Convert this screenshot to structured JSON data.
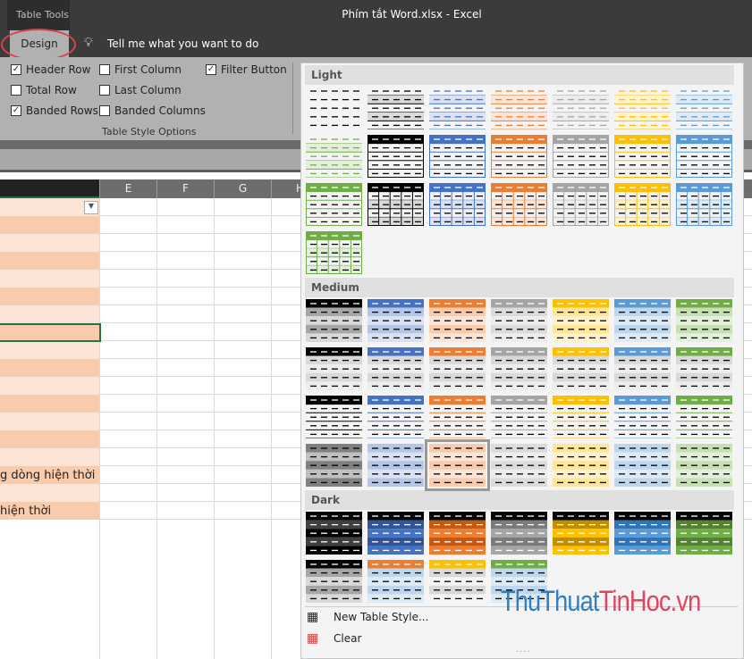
{
  "titlebar": {
    "context_tab": "Table Tools",
    "title": "Phím tắt Word.xlsx  -  Excel"
  },
  "tabs": {
    "design": "Design",
    "tell_me": "Tell me what you want to do"
  },
  "options": {
    "header_row": {
      "label": "Header Row",
      "checked": true
    },
    "total_row": {
      "label": "Total Row",
      "checked": false
    },
    "banded_rows": {
      "label": "Banded Rows",
      "checked": true
    },
    "first_column": {
      "label": "First Column",
      "checked": false
    },
    "last_column": {
      "label": "Last Column",
      "checked": false
    },
    "banded_columns": {
      "label": "Banded Columns",
      "checked": false
    },
    "filter_button": {
      "label": "Filter Button",
      "checked": true
    },
    "group_label": "Table Style Options"
  },
  "columns": [
    "E",
    "F",
    "G",
    "H"
  ],
  "rows": [
    "",
    "",
    "",
    "",
    "",
    "",
    "",
    "",
    "",
    "",
    "",
    "",
    "",
    "",
    "",
    "g dòng hiện thời",
    "",
    "hiện thời"
  ],
  "gallery": {
    "light_label": "Light",
    "medium_label": "Medium",
    "dark_label": "Dark",
    "colors": {
      "none": "#000000",
      "black": "#000000",
      "blue": "#4472c4",
      "orange": "#ed7d31",
      "gray": "#a5a5a5",
      "gold": "#ffc000",
      "lightblue": "#5b9bd5",
      "green": "#70ad47"
    },
    "selected": "Medium 10",
    "new_style": "New Table Style...",
    "clear": "Clear"
  },
  "watermark": {
    "part1": "ThuThuat",
    "part2": "TinHoc",
    "part3": ".vn",
    "color1": "#2f7fc1",
    "color2": "#e0455f"
  }
}
